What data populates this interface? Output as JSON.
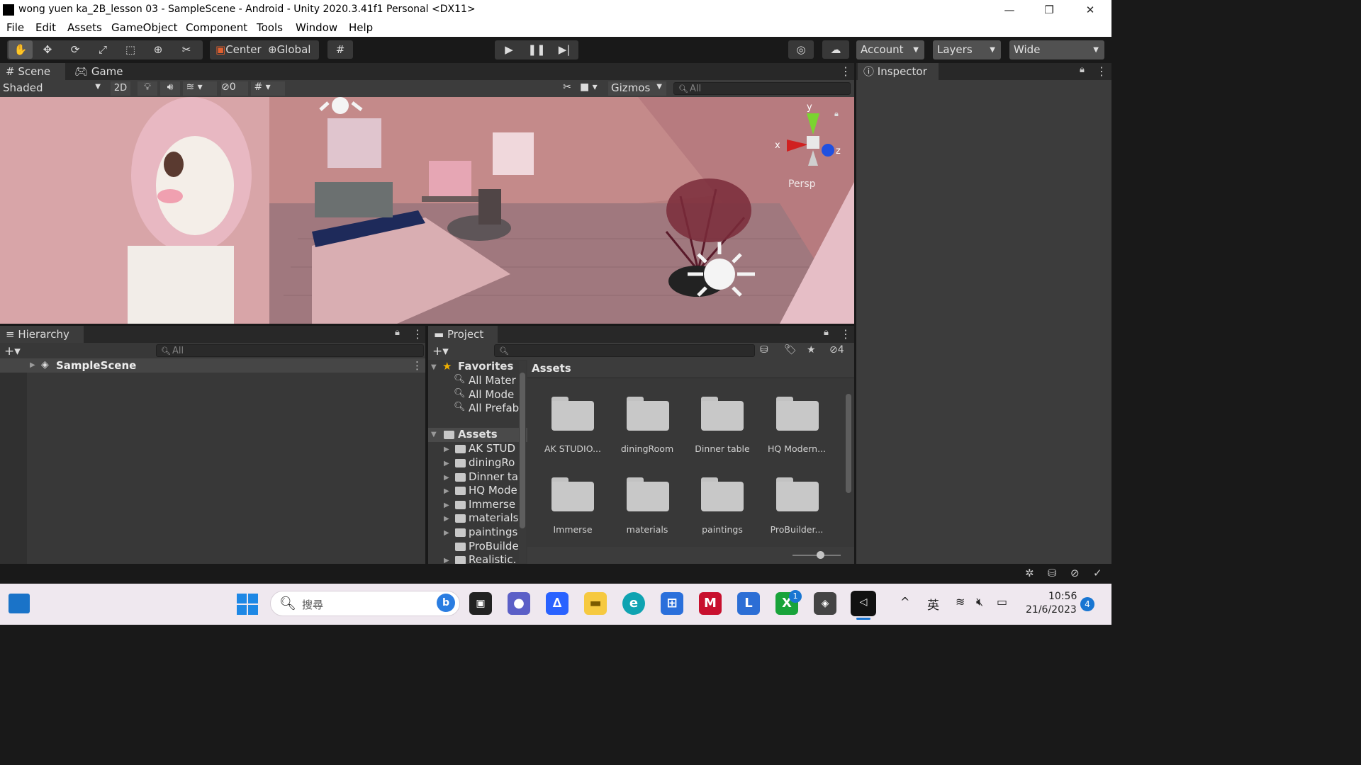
{
  "window": {
    "title": "wong yuen ka_2B_lesson 03 - SampleScene - Android - Unity 2020.3.41f1 Personal <DX11>",
    "minimize_glyph": "—",
    "restore_glyph": "❐",
    "close_glyph": "✕"
  },
  "menu": [
    "File",
    "Edit",
    "Assets",
    "GameObject",
    "Component",
    "Tools",
    "Window",
    "Help"
  ],
  "toolbar": {
    "center_label": "Center",
    "global_label": "Global",
    "account_label": "Account",
    "layers_label": "Layers",
    "layout_label": "Wide"
  },
  "scene_tabs": {
    "scene": "Scene",
    "game": "Game"
  },
  "scene_bar": {
    "shading_mode": "Shaded",
    "mode_2d": "2D",
    "hidden_count": "0",
    "gizmos_label": "Gizmos",
    "search_placeholder": "All"
  },
  "scene_view": {
    "projection_label": "Persp",
    "axis_x": "x",
    "axis_y": "y",
    "axis_z": "z",
    "colors": {
      "x_axis": "#d02020",
      "y_axis": "#7ad430",
      "z_axis": "#2050e0",
      "wall": "#c99090"
    }
  },
  "inspector": {
    "tab_label": "Inspector"
  },
  "hierarchy": {
    "tab_label": "Hierarchy",
    "search_placeholder": "All",
    "scene_name": "SampleScene"
  },
  "project": {
    "tab_label": "Project",
    "hidden_count": "4",
    "favorites_label": "Favorites",
    "favorites": [
      "All Mater",
      "All Mode",
      "All Prefab"
    ],
    "assets_root_label": "Assets",
    "tree_folders": [
      "AK STUD",
      "diningRo",
      "Dinner ta",
      "HQ Mode",
      "Immerse",
      "materials",
      "paintings",
      "ProBuilde",
      "Realistic."
    ],
    "breadcrumb": "Assets",
    "grid_folders": [
      "AK STUDIO...",
      "diningRoom",
      "Dinner table",
      "HQ Modern...",
      "Immerse",
      "materials",
      "paintings",
      "ProBuilder..."
    ]
  },
  "taskbar": {
    "search_placeholder": "搜尋",
    "ime_label": "英",
    "time": "10:56",
    "date": "21/6/2023",
    "notification_count": "4",
    "xbox_badge": "1"
  }
}
